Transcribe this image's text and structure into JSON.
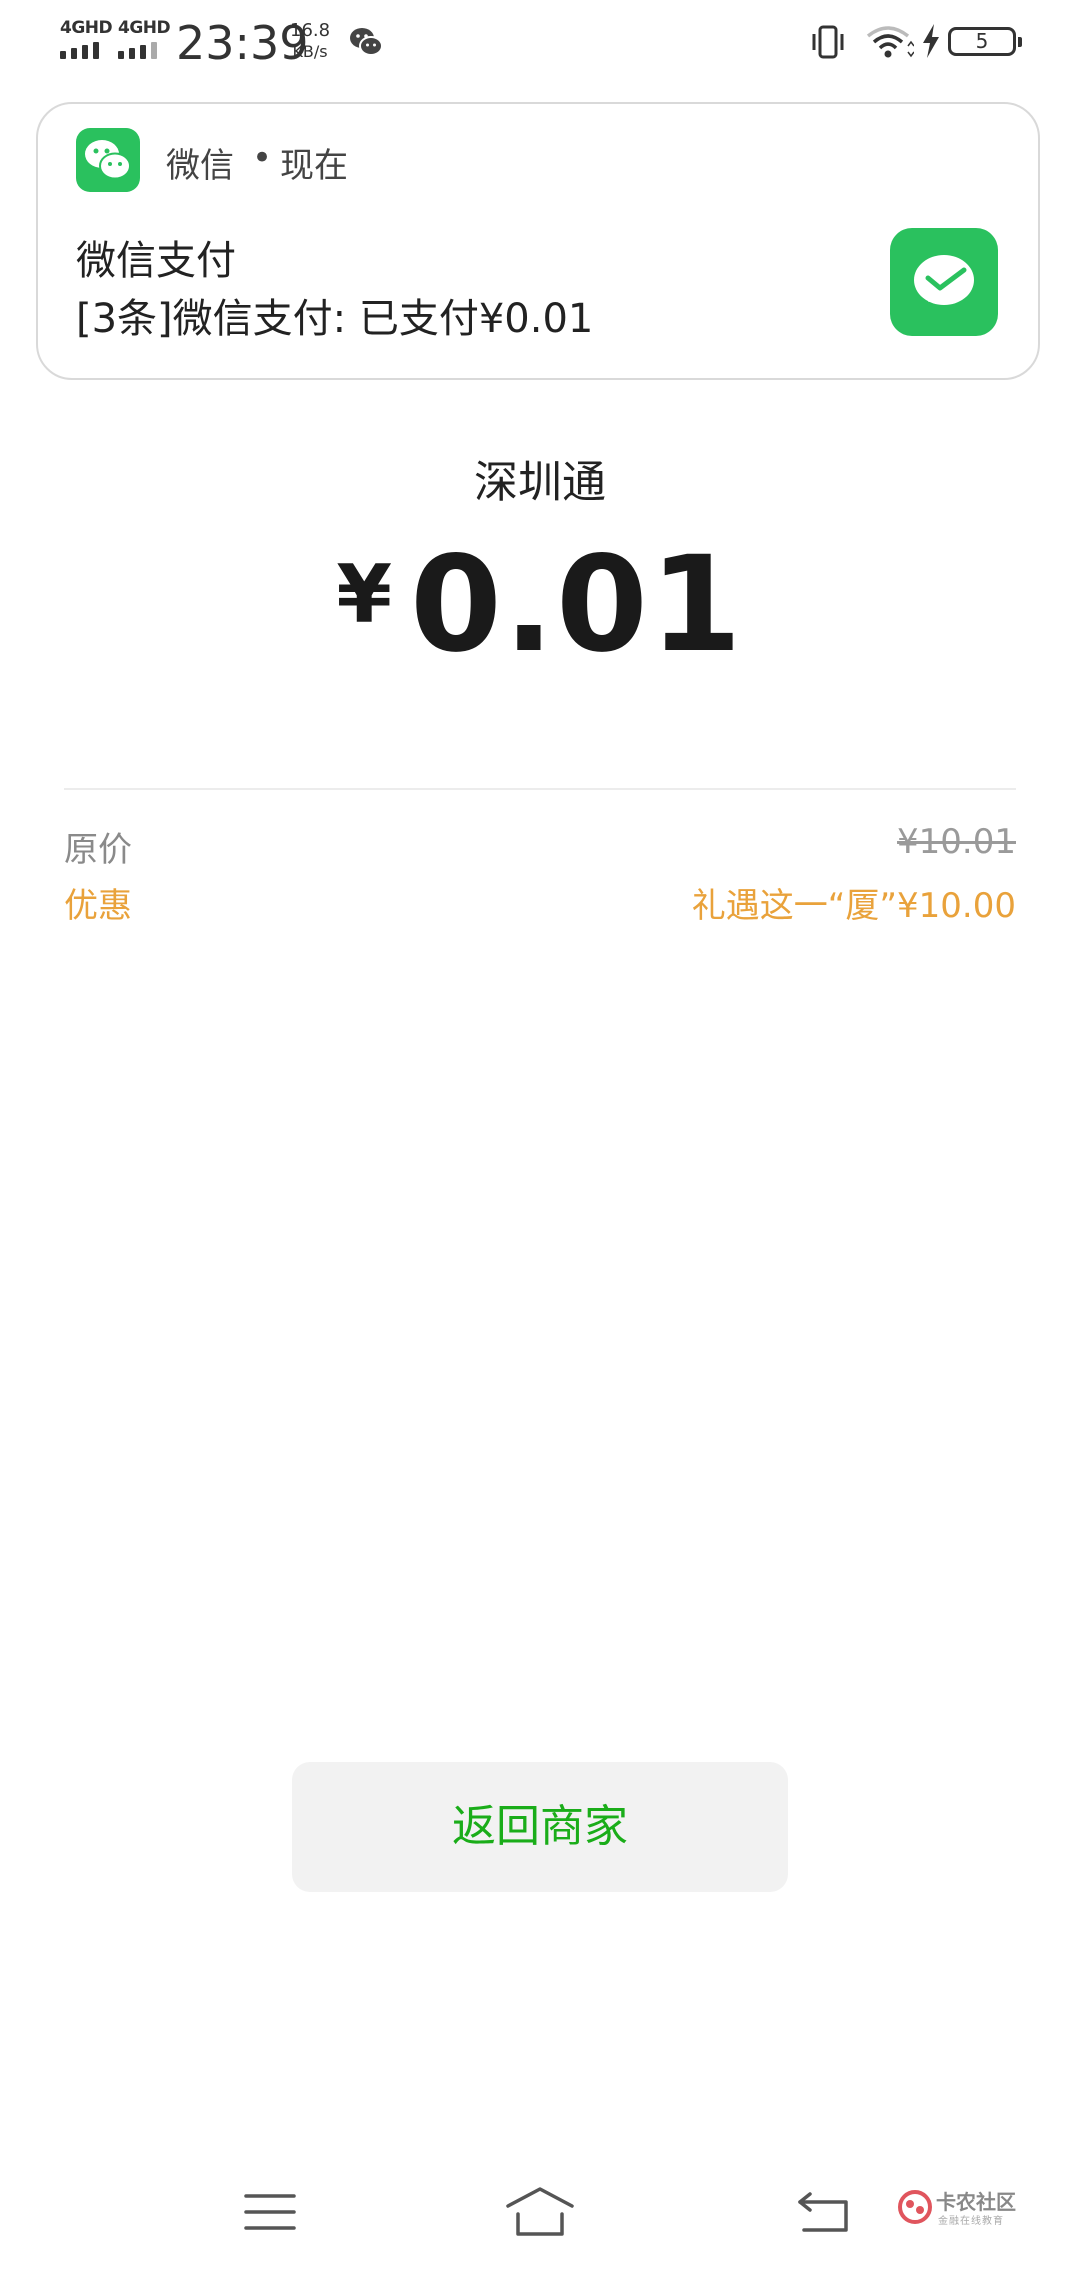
{
  "status_bar": {
    "sim1_label": "4GHD",
    "sim2_label": "4GHD",
    "time": "23:39",
    "net_speed_value": "16.8",
    "net_speed_unit": "KB/s",
    "battery_level": "5",
    "icons": [
      "wechat-icon",
      "vibrate-icon",
      "wifi-icon",
      "charging-icon",
      "battery-icon"
    ]
  },
  "notification": {
    "app_name": "微信",
    "separator": "•",
    "time": "现在",
    "title": "微信支付",
    "body": "[3条]微信支付: 已支付¥0.01",
    "brand_color": "#2ac15e"
  },
  "payment": {
    "merchant": "深圳通",
    "currency_symbol": "¥",
    "amount": "0.01",
    "original_price_label": "原价",
    "original_price_value": "¥10.01",
    "discount_label": "优惠",
    "discount_value": "礼遇这一“厦”¥10.00",
    "discount_color": "#e9a23b"
  },
  "actions": {
    "back_to_merchant": "返回商家",
    "button_text_color": "#1aad19"
  },
  "nav_bar": {
    "icons": [
      "menu-icon",
      "home-icon",
      "back-icon"
    ]
  },
  "watermark": {
    "title": "卡农社区",
    "subtitle": "金融在线教育"
  }
}
